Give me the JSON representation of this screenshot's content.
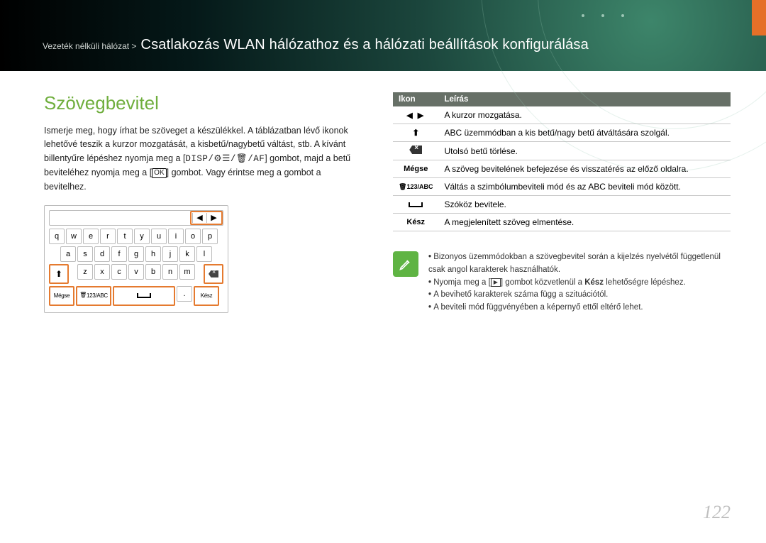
{
  "page_number": "122",
  "breadcrumb": {
    "pre": "Vezeték nélküli hálózat >",
    "main": "Csatlakozás WLAN hálózathoz és a hálózati beállítások konfigurálása"
  },
  "section_title": "Szövegbevitel",
  "intro_part1": "Ismerje meg, hogy írhat be szöveget a készülékkel. A táblázatban lévő ikonok lehetővé teszik a kurzor mozgatását, a kisbetű/nagybetű váltást, stb. A kívánt billentyűre lépéshez nyomja meg a [",
  "intro_disp": "DISP/⚙☰/🗑/AF",
  "intro_part2": "] gombot, majd a betű beviteléhez nyomja meg a [",
  "intro_ok": "OK",
  "intro_part3": "] gombot. Vagy érintse meg a gombot a bevitelhez.",
  "keyboard": {
    "row1": [
      "q",
      "w",
      "e",
      "r",
      "t",
      "y",
      "u",
      "i",
      "o",
      "p"
    ],
    "row2": [
      "a",
      "s",
      "d",
      "f",
      "g",
      "h",
      "j",
      "k",
      "l"
    ],
    "row3": [
      "z",
      "x",
      "c",
      "v",
      "b",
      "n",
      "m"
    ],
    "cancel": "Mégse",
    "mode": "123/ABC",
    "dot": ".",
    "done": "Kész"
  },
  "table": {
    "head_icon": "Ikon",
    "head_desc": "Leírás",
    "rows": [
      {
        "icon": "◀ ▶",
        "icon_class": "tri",
        "desc": "A kurzor mozgatása."
      },
      {
        "icon": "⬆",
        "icon_class": "",
        "desc": "ABC üzemmódban a kis betű/nagy betű átváltására szolgál."
      },
      {
        "icon": "bk",
        "icon_class": "bk",
        "desc": "Utolsó betű törlése."
      },
      {
        "icon": "Mégse",
        "icon_class": "bold",
        "desc": "A szöveg bevitelének befejezése és visszatérés az előző oldalra."
      },
      {
        "icon": "123/ABC",
        "icon_class": "bold small",
        "desc": "Váltás a szimbólumbeviteli mód és az ABC beviteli mód között."
      },
      {
        "icon": "space",
        "icon_class": "space",
        "desc": "Szóköz bevitele."
      },
      {
        "icon": "Kész",
        "icon_class": "bold",
        "desc": "A megjelenített szöveg elmentése."
      }
    ]
  },
  "notes": {
    "n1": "Bizonyos üzemmódokban a szövegbevitel során a kijelzés nyelvétől függetlenül csak angol karakterek használhatók.",
    "n2a": "Nyomja meg a [",
    "n2b": "] gombot közvetlenül a ",
    "n2_bold": "Kész",
    "n2c": " lehetőségre lépéshez.",
    "n3": "A bevihető karakterek száma függ a szituációtól.",
    "n4": "A beviteli mód függvényében a képernyő ettől eltérő lehet."
  }
}
